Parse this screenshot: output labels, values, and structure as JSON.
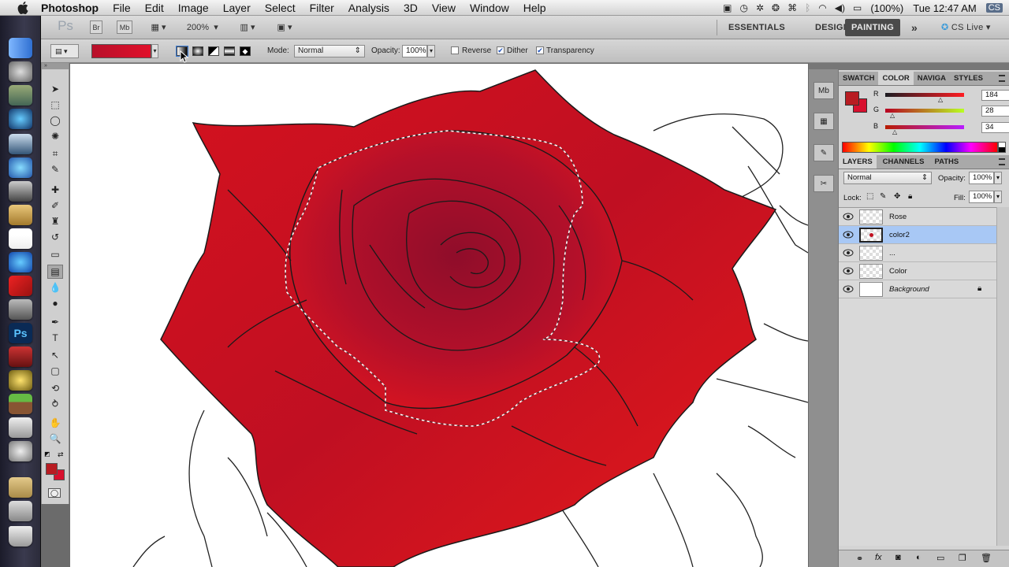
{
  "menubar": {
    "app_name": "Photoshop",
    "items": [
      "File",
      "Edit",
      "Image",
      "Layer",
      "Select",
      "Filter",
      "Analysis",
      "3D",
      "View",
      "Window",
      "Help"
    ],
    "battery": "(100%)",
    "clock": "Tue 12:47 AM",
    "input_source": "CS"
  },
  "appbar": {
    "ps_logo": "Ps",
    "br_label": "Br",
    "mb_label": "Mb",
    "zoom": "200%",
    "workspaces": [
      "ESSENTIALS",
      "DESIGN",
      "PAINTING"
    ],
    "active_workspace": "PAINTING",
    "more": "»",
    "cs_live": "CS Live"
  },
  "options": {
    "mode_label": "Mode:",
    "mode_value": "Normal",
    "opacity_label": "Opacity:",
    "opacity_value": "100%",
    "reverse_label": "Reverse",
    "reverse_checked": false,
    "dither_label": "Dither",
    "dither_checked": true,
    "transparency_label": "Transparency",
    "transparency_checked": true,
    "gradient_start": "#b8102a",
    "gradient_end": "#e0102a"
  },
  "tools": [
    {
      "name": "move-tool",
      "glyph": "➤"
    },
    {
      "name": "marquee-tool",
      "glyph": "⬚"
    },
    {
      "name": "lasso-tool",
      "glyph": "◯"
    },
    {
      "name": "quick-selection-tool",
      "glyph": "✺"
    },
    {
      "name": "crop-tool",
      "glyph": "⌗"
    },
    {
      "name": "eyedropper-tool",
      "glyph": "✎"
    },
    {
      "name": "healing-brush-tool",
      "glyph": "✚"
    },
    {
      "name": "brush-tool",
      "glyph": "✐"
    },
    {
      "name": "clone-stamp-tool",
      "glyph": "♜"
    },
    {
      "name": "history-brush-tool",
      "glyph": "↺"
    },
    {
      "name": "eraser-tool",
      "glyph": "▭"
    },
    {
      "name": "gradient-tool",
      "glyph": "▤"
    },
    {
      "name": "blur-tool",
      "glyph": "💧"
    },
    {
      "name": "dodge-tool",
      "glyph": "●"
    },
    {
      "name": "pen-tool",
      "glyph": "✒"
    },
    {
      "name": "type-tool",
      "glyph": "T"
    },
    {
      "name": "path-selection-tool",
      "glyph": "↖"
    },
    {
      "name": "shape-tool",
      "glyph": "▢"
    },
    {
      "name": "3d-rotate-tool",
      "glyph": "⟲"
    },
    {
      "name": "3d-orbit-tool",
      "glyph": "⥁"
    },
    {
      "name": "hand-tool",
      "glyph": "✋"
    },
    {
      "name": "zoom-tool",
      "glyph": "🔍"
    }
  ],
  "colors": {
    "foreground": "#b81c22",
    "background": "#d8102e"
  },
  "color_panel": {
    "tabs": [
      "SWATCH",
      "COLOR",
      "NAVIGA",
      "STYLES"
    ],
    "active_tab": "COLOR",
    "r_label": "R",
    "g_label": "G",
    "b_label": "B",
    "r_value": "184",
    "g_value": "28",
    "b_value": "34"
  },
  "layers_panel": {
    "tabs": [
      "LAYERS",
      "CHANNELS",
      "PATHS"
    ],
    "active_tab": "LAYERS",
    "blend_mode": "Normal",
    "opacity_label": "Opacity:",
    "opacity_value": "100%",
    "lock_label": "Lock:",
    "fill_label": "Fill:",
    "fill_value": "100%",
    "layers": [
      {
        "name": "Rose",
        "selected": false
      },
      {
        "name": "color2",
        "selected": true
      },
      {
        "name": "...",
        "selected": false
      },
      {
        "name": "Color",
        "selected": false
      },
      {
        "name": "Background",
        "selected": false,
        "locked": true
      }
    ]
  }
}
